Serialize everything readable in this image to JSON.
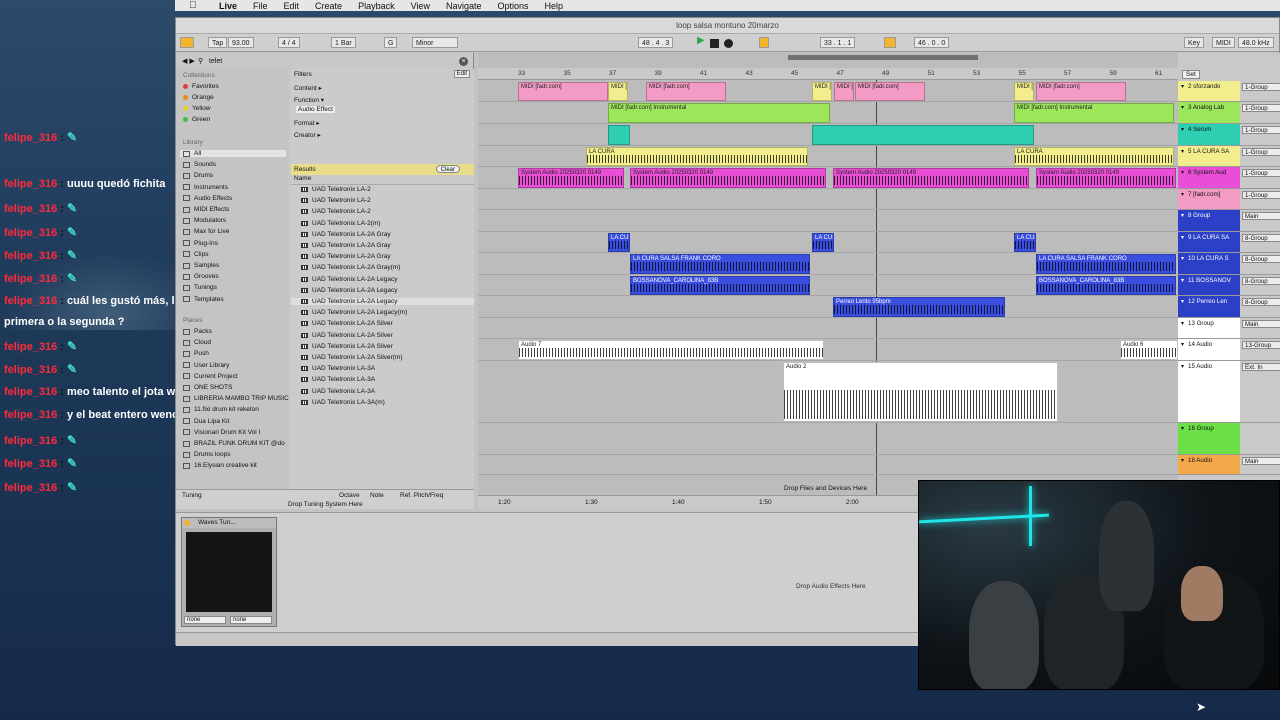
{
  "menubar": {
    "app": "Live",
    "items": [
      "File",
      "Edit",
      "Create",
      "Playback",
      "View",
      "Navigate",
      "Options",
      "Help"
    ]
  },
  "chat": {
    "lines": [
      {
        "user": "felipe_316",
        "msg": "",
        "emote": "✎"
      },
      {
        "user": "felipe_316",
        "msg": "uuuu quedó fichita",
        "emote": ""
      },
      {
        "user": "felipe_316",
        "msg": "",
        "emote": "✎"
      },
      {
        "user": "felipe_316",
        "msg": "",
        "emote": "✎"
      },
      {
        "user": "felipe_316",
        "msg": "",
        "emote": "✎"
      },
      {
        "user": "felipe_316",
        "msg": "",
        "emote": "✎"
      },
      {
        "user": "felipe_316",
        "msg": "cuál les gustó más, la",
        "emote": ""
      },
      {
        "user": "",
        "msg": "primera o la segunda ?",
        "emote": ""
      },
      {
        "user": "felipe_316",
        "msg": "",
        "emote": "✎"
      },
      {
        "user": "felipe_316",
        "msg": "",
        "emote": "✎"
      },
      {
        "user": "felipe_316",
        "msg": "meo talento el jota wn",
        "emote": ""
      },
      {
        "user": "felipe_316",
        "msg": "y el beat entero weno wn",
        "emote": ""
      },
      {
        "user": "felipe_316",
        "msg": "",
        "emote": "✎"
      },
      {
        "user": "felipe_316",
        "msg": "",
        "emote": "✎"
      },
      {
        "user": "felipe_316",
        "msg": "",
        "emote": "✎"
      }
    ]
  },
  "window": {
    "title": "loop  salsa montuno 20marzo"
  },
  "transport": {
    "tap": "Tap",
    "tempo": "93.00",
    "signature": "4 / 4",
    "quant": "1 Bar",
    "key": "G",
    "scale": "Minor",
    "position": "48 .  4 .  3",
    "loop_start": "33 .  1 .  1",
    "loop_len": "46 .  0 .  0",
    "key_btn": "Key",
    "midi_btn": "MIDI",
    "sample_rate": "48.0 kHz"
  },
  "browser": {
    "search": "telet",
    "collections_header": "Collections",
    "collections": [
      {
        "label": "Favorites",
        "color": "#e23a3a"
      },
      {
        "label": "Orange",
        "color": "#f08a1c"
      },
      {
        "label": "Yellow",
        "color": "#e8d21e"
      },
      {
        "label": "Green",
        "color": "#3fbf3f"
      }
    ],
    "library_header": "Library",
    "library": [
      "All",
      "Sounds",
      "Drums",
      "Instruments",
      "Audio Effects",
      "MIDI Effects",
      "Modulators",
      "Max for Live",
      "Plug-Ins",
      "Clips",
      "Samples",
      "Grooves",
      "Tunings",
      "Templates"
    ],
    "places_header": "Places",
    "places": [
      "Packs",
      "Cloud",
      "Push",
      "User Library",
      "Current Project",
      "ONE SHOTS",
      "LIBRERIA MAMBO TRIP MUSIC",
      "11.fixi drum kit reketon",
      "Dua Lipa Kit",
      "Visionari Drum Kit Vol I",
      "BRAZIL FUNK DRUM KIT @do",
      "Drums loops",
      "16.Elysian  creative kit"
    ],
    "filters_label": "Filters",
    "edit_label": "Edit",
    "filters": [
      "Content ▸",
      "Function ▾",
      "Audio Effect",
      "Format ▸",
      "Creator ▸"
    ],
    "results_label": "Results",
    "clear_label": "Clear",
    "name_col": "Name",
    "results": [
      "UAD Teletronix LA-2",
      "UAD Teletronix LA-2",
      "UAD Teletronix LA-2",
      "UAD Teletronix LA-2(m)",
      "UAD Teletronix LA-2A Gray",
      "UAD Teletronix LA-2A Gray",
      "UAD Teletronix LA-2A Gray",
      "UAD Teletronix LA-2A Gray(m)",
      "UAD Teletronix LA-2A Legacy",
      "UAD Teletronix LA-2A Legacy",
      "UAD Teletronix LA-2A Legacy",
      "UAD Teletronix LA-2A Legacy(m)",
      "UAD Teletronix LA-2A Silver",
      "UAD Teletronix LA-2A Silver",
      "UAD Teletronix LA-2A Silver",
      "UAD Teletronix LA-2A Silver(m)",
      "UAD Teletronix LA-3A",
      "UAD Teletronix LA-3A",
      "UAD Teletronix LA-3A",
      "UAD Teletronix LA-3A(m)"
    ],
    "tuning": {
      "label": "Tuning",
      "octave": "Octave",
      "note": "Note",
      "ref": "Ref. Pitch/Freq",
      "drop": "Drop Tuning System Here"
    }
  },
  "arrangement": {
    "bars": [
      "33",
      "35",
      "37",
      "39",
      "41",
      "43",
      "45",
      "47",
      "49",
      "51",
      "53",
      "55",
      "57",
      "59",
      "61"
    ],
    "times": [
      "1:20",
      "1:30",
      "1:40",
      "1:50",
      "2:00"
    ],
    "set_label": "Set",
    "drop_hint": "Drop Files and Devices Here",
    "clip_text": {
      "midi": "MIDI [fadr.com]",
      "instrumental": "MIDI [fadr.com] Instrumental",
      "lacura": "LA CURA",
      "system": "System Audio 20250320 0149",
      "frank": "LA CURA SALSA FRANK CORO",
      "bossa": "BOSSANOVA_CAROLINA_83B",
      "perreo": "Perreo Lento 95bpm",
      "audio7": "Audio 7",
      "audio2": "Audio 2",
      "audio6": "Audio 6"
    }
  },
  "tracks": [
    {
      "name": "2 sforzando",
      "route": "1-Group",
      "color": "#f2ee8e"
    },
    {
      "name": "3 Analog Lab",
      "route": "1-Group",
      "color": "#9be65a"
    },
    {
      "name": "4 Serum",
      "route": "1-Group",
      "color": "#2ecfb0"
    },
    {
      "name": "5 LA CURA SA",
      "route": "1-Group",
      "color": "#f2ee8e"
    },
    {
      "name": "6 System Aud",
      "route": "1-Group",
      "color": "#e84fd6"
    },
    {
      "name": "7 [fadr.com]",
      "route": "1-Group",
      "color": "#f39ac5"
    },
    {
      "name": "8 Group",
      "route": "Main",
      "color": "#2b3fc7"
    },
    {
      "name": "9 LA CURA SA",
      "route": "8-Group",
      "color": "#2b3fc7"
    },
    {
      "name": "10 LA CURA S",
      "route": "8-Group",
      "color": "#2b3fc7"
    },
    {
      "name": "11 BOSSANOV",
      "route": "8-Group",
      "color": "#2b3fc7"
    },
    {
      "name": "12 Perreo Len",
      "route": "8-Group",
      "color": "#2b3fc7"
    },
    {
      "name": "13 Group",
      "route": "Main",
      "color": "#ffffff"
    },
    {
      "name": "14 Audio",
      "route": "13-Group",
      "color": "#ffffff"
    },
    {
      "name": "15 Audio",
      "route": "Ext. In",
      "color": "#ffffff"
    },
    {
      "name": "16 Group",
      "route": "",
      "color": "#6be046"
    },
    {
      "name": "18 Audio",
      "route": "Main",
      "color": "#f3a94a"
    }
  ],
  "device": {
    "name": "Waves Tun...",
    "sel1": "none",
    "sel2": "none",
    "drop_fx": "Drop Audio Effects Here"
  }
}
